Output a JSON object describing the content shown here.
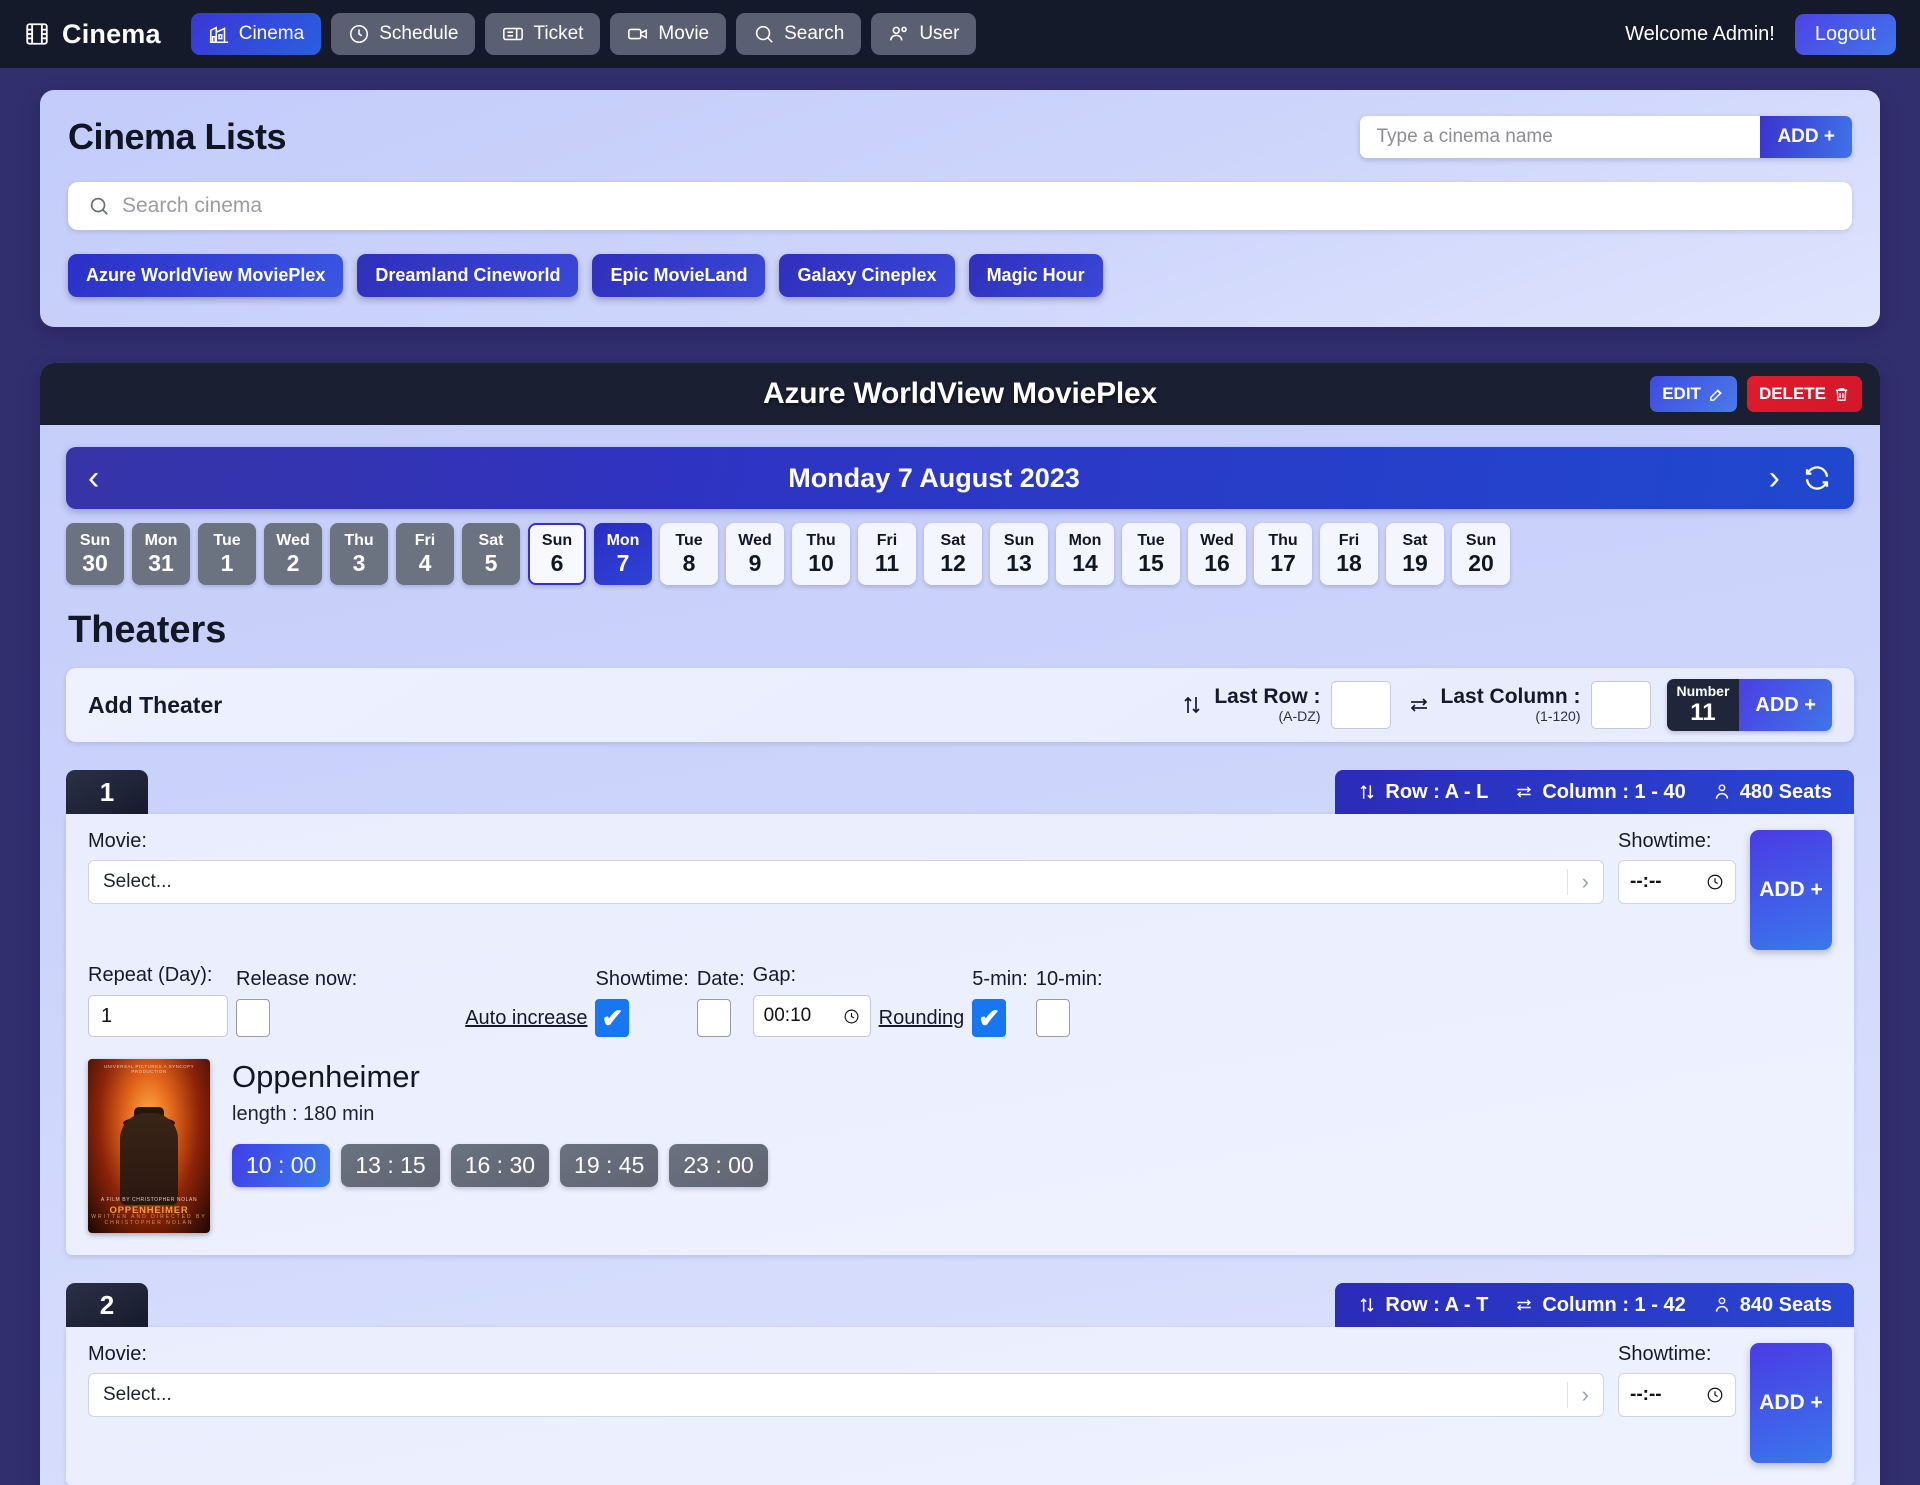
{
  "navbar": {
    "brand": "Cinema",
    "items": [
      {
        "label": "Cinema",
        "icon": "cinema-building-icon",
        "active": true
      },
      {
        "label": "Schedule",
        "icon": "clock-icon",
        "active": false
      },
      {
        "label": "Ticket",
        "icon": "ticket-icon",
        "active": false
      },
      {
        "label": "Movie",
        "icon": "video-camera-icon",
        "active": false
      },
      {
        "label": "Search",
        "icon": "search-icon",
        "active": false
      },
      {
        "label": "User",
        "icon": "users-icon",
        "active": false
      }
    ],
    "welcome": "Welcome Admin!",
    "logout": "Logout"
  },
  "cinema_lists": {
    "title": "Cinema Lists",
    "add_placeholder": "Type a cinema name",
    "add_value": "",
    "add_button": "ADD +",
    "search_placeholder": "Search cinema",
    "search_value": "",
    "chips": [
      {
        "label": "Azure WorldView MoviePlex",
        "active": true
      },
      {
        "label": "Dreamland Cineworld",
        "active": false
      },
      {
        "label": "Epic MovieLand",
        "active": false
      },
      {
        "label": "Galaxy Cineplex",
        "active": false
      },
      {
        "label": "Magic Hour",
        "active": false
      }
    ]
  },
  "detail": {
    "title": "Azure WorldView MoviePlex",
    "edit_label": "EDIT",
    "delete_label": "DELETE",
    "date_title": "Monday 7 August 2023",
    "days": [
      {
        "dow": "Sun",
        "d": "30",
        "state": "past"
      },
      {
        "dow": "Mon",
        "d": "31",
        "state": "past"
      },
      {
        "dow": "Tue",
        "d": "1",
        "state": "past"
      },
      {
        "dow": "Wed",
        "d": "2",
        "state": "past"
      },
      {
        "dow": "Thu",
        "d": "3",
        "state": "past"
      },
      {
        "dow": "Fri",
        "d": "4",
        "state": "past"
      },
      {
        "dow": "Sat",
        "d": "5",
        "state": "past"
      },
      {
        "dow": "Sun",
        "d": "6",
        "state": "today"
      },
      {
        "dow": "Mon",
        "d": "7",
        "state": "selected"
      },
      {
        "dow": "Tue",
        "d": "8",
        "state": "future"
      },
      {
        "dow": "Wed",
        "d": "9",
        "state": "future"
      },
      {
        "dow": "Thu",
        "d": "10",
        "state": "future"
      },
      {
        "dow": "Fri",
        "d": "11",
        "state": "future"
      },
      {
        "dow": "Sat",
        "d": "12",
        "state": "future"
      },
      {
        "dow": "Sun",
        "d": "13",
        "state": "future"
      },
      {
        "dow": "Mon",
        "d": "14",
        "state": "future"
      },
      {
        "dow": "Tue",
        "d": "15",
        "state": "future"
      },
      {
        "dow": "Wed",
        "d": "16",
        "state": "future"
      },
      {
        "dow": "Thu",
        "d": "17",
        "state": "future"
      },
      {
        "dow": "Fri",
        "d": "18",
        "state": "future"
      },
      {
        "dow": "Sat",
        "d": "19",
        "state": "future"
      },
      {
        "dow": "Sun",
        "d": "20",
        "state": "future"
      }
    ]
  },
  "theaters_heading": "Theaters",
  "add_theater": {
    "label": "Add Theater",
    "last_row_label": "Last Row :",
    "last_row_hint": "(A-DZ)",
    "last_row_value": "",
    "last_col_label": "Last Column :",
    "last_col_hint": "(1-120)",
    "last_col_value": "",
    "number_label": "Number",
    "number_value": "11",
    "add_button": "ADD +"
  },
  "theaters": [
    {
      "number": "1",
      "row_label": "Row : A - L",
      "column_label": "Column : 1 - 40",
      "seats_label": "480 Seats",
      "movie_label": "Movie:",
      "movie_value": "Select...",
      "showtime_label": "Showtime:",
      "showtime_value": "--:--",
      "add_button": "ADD +",
      "options": {
        "repeat_label": "Repeat (Day):",
        "repeat_value": "1",
        "release_label": "Release now:",
        "release_checked": false,
        "auto_increase_label": "Auto increase",
        "showtime_label": "Showtime:",
        "showtime_checked": true,
        "date_label": "Date:",
        "date_checked": false,
        "gap_label": "Gap:",
        "gap_value": "00:10",
        "rounding_label": "Rounding",
        "five_min_label": "5-min:",
        "five_min_checked": true,
        "ten_min_label": "10-min:",
        "ten_min_checked": false
      },
      "movies": [
        {
          "title": "Oppenheimer",
          "length": "length : 180 min",
          "poster_top_credits": "UNIVERSAL PICTURES  A SYNCOPY PRODUCTION",
          "poster_director": "A FILM BY CHRISTOPHER NOLAN",
          "poster_title": "OPPENHEIMER",
          "poster_bottom": "WRITTEN AND DIRECTED BY CHRISTOPHER NOLAN",
          "showtimes": [
            {
              "time": "10 : 00",
              "selected": true
            },
            {
              "time": "13 : 15",
              "selected": false
            },
            {
              "time": "16 : 30",
              "selected": false
            },
            {
              "time": "19 : 45",
              "selected": false
            },
            {
              "time": "23 : 00",
              "selected": false
            }
          ]
        }
      ]
    },
    {
      "number": "2",
      "row_label": "Row : A - T",
      "column_label": "Column : 1 - 42",
      "seats_label": "840 Seats",
      "movie_label": "Movie:",
      "movie_value": "Select...",
      "showtime_label": "Showtime:",
      "showtime_value": "--:--",
      "add_button": "ADD +"
    }
  ],
  "colors": {
    "page_bg": "#322f6e",
    "navbar_bg": "#151a2b",
    "accent_blue": "#2f33c2",
    "accent_blue_light": "#3b7aea",
    "danger_red": "#e01b2c",
    "checkbox_on": "#1777f2",
    "card_bg": "#cdd5fb"
  }
}
